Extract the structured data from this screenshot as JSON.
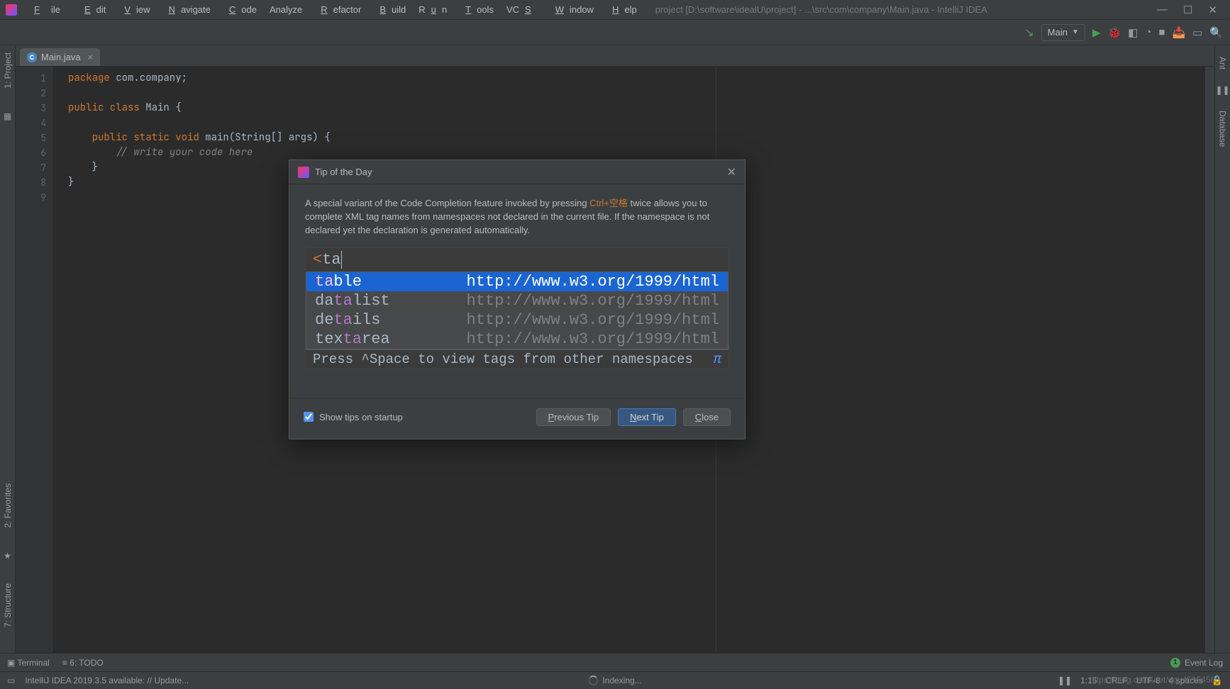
{
  "menubar": {
    "file": "File",
    "edit": "Edit",
    "view": "View",
    "navigate": "Navigate",
    "code": "Code",
    "analyze": "Analyze",
    "refactor": "Refactor",
    "build": "Build",
    "run": "Run",
    "tools": "Tools",
    "vcs": "VCS",
    "window": "Window",
    "help": "Help"
  },
  "titlepath": "project [D:\\software\\idealU\\project] - ...\\src\\com\\company\\Main.java - IntelliJ IDEA",
  "run_config": {
    "label": "Main"
  },
  "file_tab": {
    "name": "Main.java",
    "icon": "C"
  },
  "gutter": [
    "1",
    "2",
    "3",
    "4",
    "5",
    "6",
    "7",
    "8",
    "9"
  ],
  "code": {
    "l1a": "package",
    "l1b": " com.company;",
    "l3a": "public class",
    "l3b": " Main {",
    "l5a": "    public static void",
    "l5b": " main(String[] args) {",
    "l6a": "        // write your code here",
    "l7": "    }",
    "l8": "}"
  },
  "left_tabs": {
    "project": "1: Project",
    "favorites": "2: Favorites",
    "structure": "7: Structure"
  },
  "right_tabs": {
    "ant": "Ant",
    "database": "Database"
  },
  "bottom": {
    "terminal": "Terminal",
    "todo": "6: TODO",
    "eventlog": "Event Log",
    "badge": "1"
  },
  "statusbar": {
    "update": "IntelliJ IDEA 2019.3.5 available: // Update...",
    "indexing": "Indexing...",
    "pos": "1:15",
    "crlf": "CRLF",
    "enc": "UTF-8",
    "spaces": "4 spaces"
  },
  "watermark": "https://blog.csdn.net/qq_45154565",
  "dialog": {
    "title": "Tip of the Day",
    "text_before": "A special variant of the Code Completion feature invoked by pressing ",
    "shortcut": "Ctrl+空格",
    "text_after": " twice allows you to complete XML tag names from namespaces not declared in the current file. If the namespace is not declared yet the declaration is generated automatically.",
    "input_bracket": "<",
    "input_text": "ta",
    "rows": [
      {
        "pre": "ta",
        "suf": "ble",
        "ns": "http://www.w3.org/1999/html",
        "sel": true
      },
      {
        "pre": "da",
        "hl": "ta",
        "suf": "list",
        "ns": "http://www.w3.org/1999/html",
        "sel": false
      },
      {
        "pre": "de",
        "hl": "ta",
        "suf": "ils",
        "ns": "http://www.w3.org/1999/html",
        "sel": false
      },
      {
        "pre": "tex",
        "hl": "ta",
        "suf": "rea",
        "ns": "http://www.w3.org/1999/html",
        "sel": false
      }
    ],
    "hint": "Press ^Space to view tags from other namespaces",
    "pi": "π",
    "checkbox": "Show tips on startup",
    "prev": "Previous Tip",
    "next": "Next Tip",
    "close": "Close"
  }
}
